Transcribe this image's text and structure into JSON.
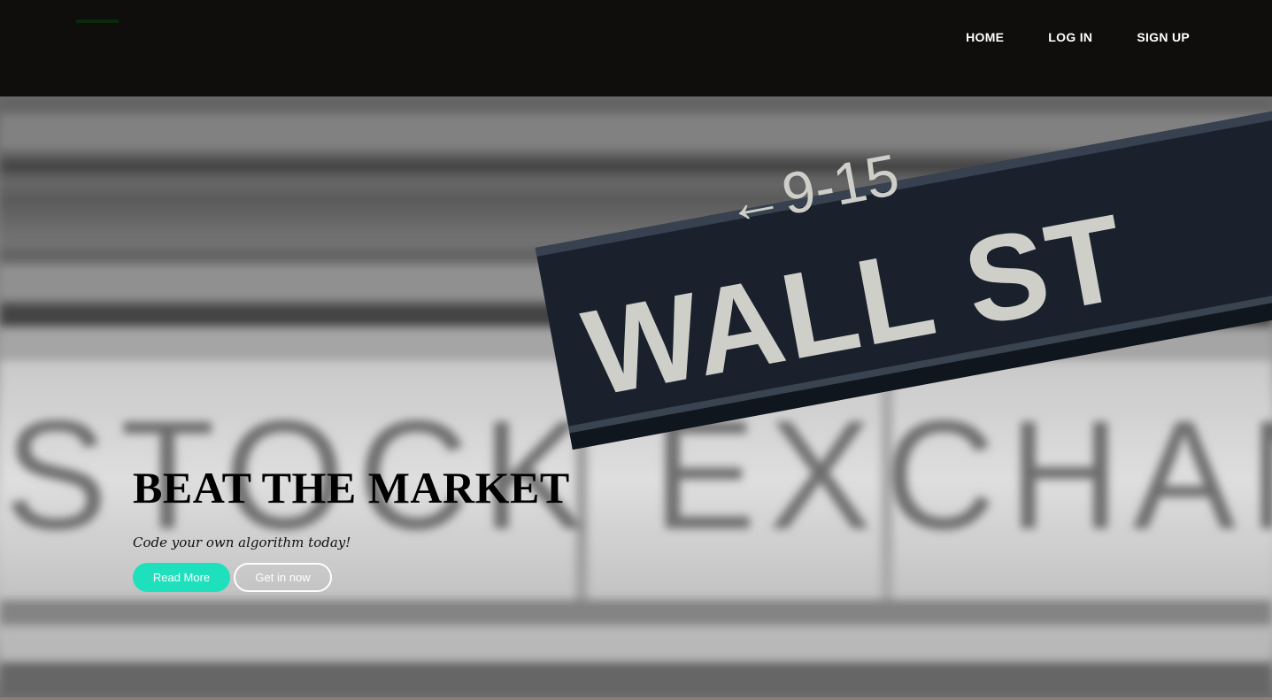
{
  "nav": {
    "links": [
      "HOME",
      "LOG IN",
      "SIGN UP"
    ]
  },
  "hero": {
    "background_sign_text": "WALL ST",
    "background_sign_number": "←9-15",
    "background_building_text": "STOCK EXCHAN",
    "title": "BEAT THE MARKET",
    "subtitle": "Code your own algorithm today!",
    "primary_button": "Read More",
    "secondary_button": "Get in now"
  },
  "colors": {
    "navbar": "#0f0e0c",
    "accent": "#1ee0bd",
    "sign": "#1c2430"
  }
}
